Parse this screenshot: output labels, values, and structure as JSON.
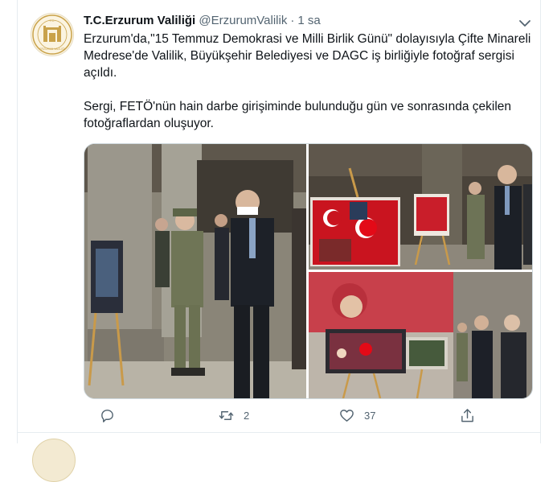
{
  "tweet": {
    "author_name": "T.C.Erzurum Valiliği",
    "handle": "@ErzurumValilik",
    "separator": "·",
    "time": "1 sa",
    "paragraphs": [
      "Erzurum'da,\"15 Temmuz Demokrasi ve Milli Birlik Günü\" dolayısıyla Çifte Minareli Medrese'de Valilik, Büyükşehir Belediyesi ve DAGC iş birliğiyle fotoğraf sergisi açıldı.",
      "Sergi, FETÖ'nün hain darbe girişiminde bulunduğu gün ve sonrasında çekilen fotoğraflardan oluşuyor."
    ],
    "avatar_logo_text": "T.C. ERZURUM VALİLİĞİ",
    "actions": {
      "reply_count": "",
      "retweet_count": "2",
      "like_count": "37"
    }
  },
  "icons": {
    "reply": "reply-icon",
    "retweet": "retweet-icon",
    "like": "heart-icon",
    "share": "share-icon",
    "more": "chevron-down-icon"
  },
  "colors": {
    "text_primary": "#0f1419",
    "text_secondary": "#536471",
    "border": "#e6ecf0",
    "flag_red": "#e30a17"
  }
}
